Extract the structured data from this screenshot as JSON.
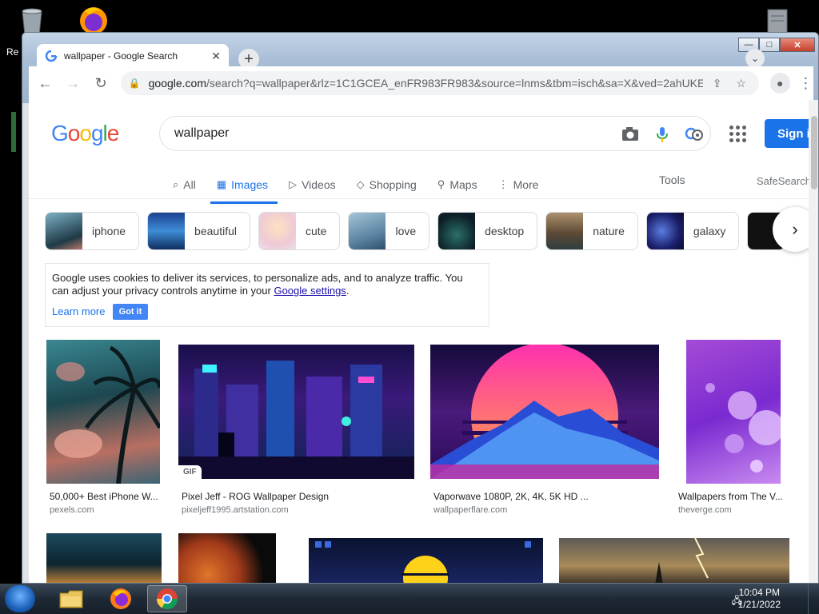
{
  "desktop": {
    "recycle_label": "Re"
  },
  "window": {
    "tab_title": "wallpaper - Google Search",
    "tab_close": "✕",
    "new_tab": "+",
    "tab_search": "⌄",
    "minimize": "—",
    "maximize": "□",
    "close": "✕"
  },
  "toolbar": {
    "back": "←",
    "forward": "→",
    "reload": "↻",
    "url_host": "google.com",
    "url_rest": "/search?q=wallpaper&rlz=1C1GCEA_enFR983FR983&source=lnms&tbm=isch&sa=X&ved=2ahUKE...",
    "share": "⇪",
    "bookmark": "☆",
    "profile": "●",
    "menu": "⋮"
  },
  "google": {
    "logo": [
      "G",
      "o",
      "o",
      "g",
      "l",
      "e"
    ],
    "query": "wallpaper",
    "sign_in": "Sign i",
    "tabs": [
      {
        "icon": "⌕",
        "label": "All"
      },
      {
        "icon": "▦",
        "label": "Images"
      },
      {
        "icon": "▷",
        "label": "Videos"
      },
      {
        "icon": "◇",
        "label": "Shopping"
      },
      {
        "icon": "⚲",
        "label": "Maps"
      },
      {
        "icon": "⋮",
        "label": "More"
      }
    ],
    "tools": "Tools",
    "safesearch": "SafeSearch",
    "chips": [
      "iphone",
      "beautiful",
      "cute",
      "love",
      "desktop",
      "nature",
      "galaxy"
    ],
    "chip_next": "›",
    "cookie": {
      "text": "Google uses cookies to deliver its services, to personalize ads, and to analyze traffic. You can adjust your privacy controls anytime in your ",
      "link": "Google settings",
      "end": ".",
      "learn_more": "Learn more",
      "got_it": "Got it"
    },
    "results": [
      {
        "title": "50,000+ Best iPhone W...",
        "source": "pexels.com"
      },
      {
        "title": "Pixel Jeff - ROG Wallpaper Design",
        "source": "pixeljeff1995.artstation.com",
        "badge": "GIF"
      },
      {
        "title": "Vaporwave 1080P, 2K, 4K, 5K HD ...",
        "source": "wallpaperflare.com"
      },
      {
        "title": "Wallpapers from The V...",
        "source": "theverge.com"
      }
    ]
  },
  "taskbar": {
    "time": "10:04 PM",
    "date": "1/21/2022",
    "tray": "🖧"
  }
}
